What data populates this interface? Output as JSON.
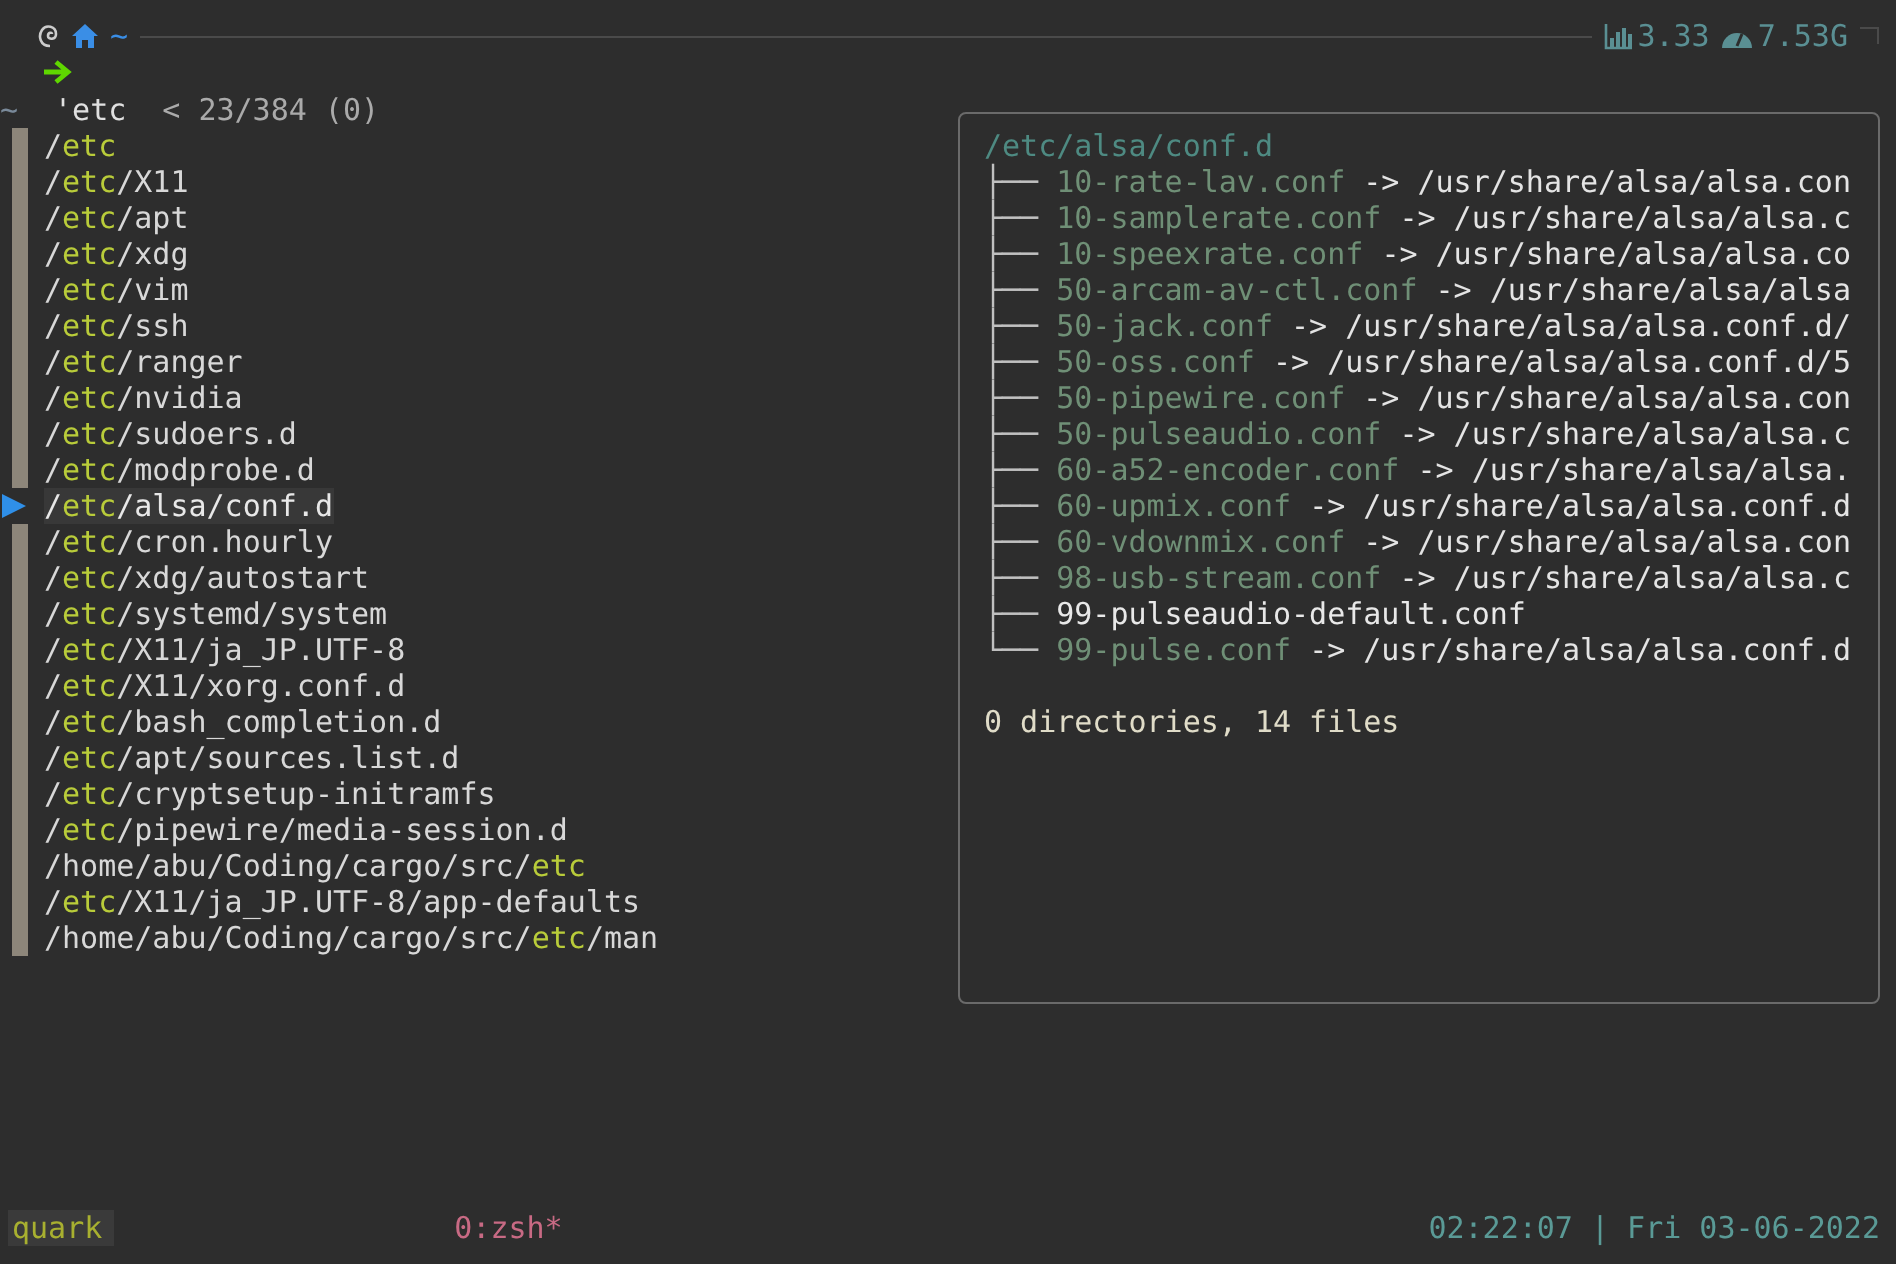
{
  "prompt": {
    "path": "~",
    "load": "3.33",
    "memory": "7.53G"
  },
  "query": {
    "dir": "~",
    "text": "'etc",
    "counter": "< 23/384 (0)"
  },
  "results": [
    {
      "selected": false,
      "parts": [
        {
          "text": "/"
        },
        {
          "text": "etc",
          "match": true
        }
      ]
    },
    {
      "selected": false,
      "parts": [
        {
          "text": "/"
        },
        {
          "text": "etc",
          "match": true
        },
        {
          "text": "/X11"
        }
      ]
    },
    {
      "selected": false,
      "parts": [
        {
          "text": "/"
        },
        {
          "text": "etc",
          "match": true
        },
        {
          "text": "/apt"
        }
      ]
    },
    {
      "selected": false,
      "parts": [
        {
          "text": "/"
        },
        {
          "text": "etc",
          "match": true
        },
        {
          "text": "/xdg"
        }
      ]
    },
    {
      "selected": false,
      "parts": [
        {
          "text": "/"
        },
        {
          "text": "etc",
          "match": true
        },
        {
          "text": "/vim"
        }
      ]
    },
    {
      "selected": false,
      "parts": [
        {
          "text": "/"
        },
        {
          "text": "etc",
          "match": true
        },
        {
          "text": "/ssh"
        }
      ]
    },
    {
      "selected": false,
      "parts": [
        {
          "text": "/"
        },
        {
          "text": "etc",
          "match": true
        },
        {
          "text": "/ranger"
        }
      ]
    },
    {
      "selected": false,
      "parts": [
        {
          "text": "/"
        },
        {
          "text": "etc",
          "match": true
        },
        {
          "text": "/nvidia"
        }
      ]
    },
    {
      "selected": false,
      "parts": [
        {
          "text": "/"
        },
        {
          "text": "etc",
          "match": true
        },
        {
          "text": "/sudoers.d"
        }
      ]
    },
    {
      "selected": false,
      "parts": [
        {
          "text": "/"
        },
        {
          "text": "etc",
          "match": true
        },
        {
          "text": "/modprobe.d"
        }
      ]
    },
    {
      "selected": true,
      "parts": [
        {
          "text": "/"
        },
        {
          "text": "etc",
          "match": true
        },
        {
          "text": "/alsa/conf.d"
        }
      ]
    },
    {
      "selected": false,
      "parts": [
        {
          "text": "/"
        },
        {
          "text": "etc",
          "match": true
        },
        {
          "text": "/cron.hourly"
        }
      ]
    },
    {
      "selected": false,
      "parts": [
        {
          "text": "/"
        },
        {
          "text": "etc",
          "match": true
        },
        {
          "text": "/xdg/autostart"
        }
      ]
    },
    {
      "selected": false,
      "parts": [
        {
          "text": "/"
        },
        {
          "text": "etc",
          "match": true
        },
        {
          "text": "/systemd/system"
        }
      ]
    },
    {
      "selected": false,
      "parts": [
        {
          "text": "/"
        },
        {
          "text": "etc",
          "match": true
        },
        {
          "text": "/X11/ja_JP.UTF-8"
        }
      ]
    },
    {
      "selected": false,
      "parts": [
        {
          "text": "/"
        },
        {
          "text": "etc",
          "match": true
        },
        {
          "text": "/X11/xorg.conf.d"
        }
      ]
    },
    {
      "selected": false,
      "parts": [
        {
          "text": "/"
        },
        {
          "text": "etc",
          "match": true
        },
        {
          "text": "/bash_completion.d"
        }
      ]
    },
    {
      "selected": false,
      "parts": [
        {
          "text": "/"
        },
        {
          "text": "etc",
          "match": true
        },
        {
          "text": "/apt/sources.list.d"
        }
      ]
    },
    {
      "selected": false,
      "parts": [
        {
          "text": "/"
        },
        {
          "text": "etc",
          "match": true
        },
        {
          "text": "/cryptsetup-initramfs"
        }
      ]
    },
    {
      "selected": false,
      "parts": [
        {
          "text": "/"
        },
        {
          "text": "etc",
          "match": true
        },
        {
          "text": "/pipewire/media-session.d"
        }
      ]
    },
    {
      "selected": false,
      "parts": [
        {
          "text": "/home/abu/Coding/cargo/src/"
        },
        {
          "text": "etc",
          "match": true
        }
      ]
    },
    {
      "selected": false,
      "parts": [
        {
          "text": "/"
        },
        {
          "text": "etc",
          "match": true
        },
        {
          "text": "/X11/ja_JP.UTF-8/app-defaults"
        }
      ]
    },
    {
      "selected": false,
      "parts": [
        {
          "text": "/home/abu/Coding/cargo/src/"
        },
        {
          "text": "etc",
          "match": true
        },
        {
          "text": "/man"
        }
      ]
    }
  ],
  "preview": {
    "header": "/etc/alsa/conf.d",
    "entries": [
      {
        "branch": "├──",
        "kind": "symlink",
        "name": "10-rate-lav.conf",
        "target": "-> /usr/share/alsa/alsa.con"
      },
      {
        "branch": "├──",
        "kind": "symlink",
        "name": "10-samplerate.conf",
        "target": "-> /usr/share/alsa/alsa.c"
      },
      {
        "branch": "├──",
        "kind": "symlink",
        "name": "10-speexrate.conf",
        "target": "-> /usr/share/alsa/alsa.co"
      },
      {
        "branch": "├──",
        "kind": "symlink",
        "name": "50-arcam-av-ctl.conf",
        "target": "-> /usr/share/alsa/alsa"
      },
      {
        "branch": "├──",
        "kind": "symlink",
        "name": "50-jack.conf",
        "target": "-> /usr/share/alsa/alsa.conf.d/"
      },
      {
        "branch": "├──",
        "kind": "symlink",
        "name": "50-oss.conf",
        "target": "-> /usr/share/alsa/alsa.conf.d/5"
      },
      {
        "branch": "├──",
        "kind": "symlink",
        "name": "50-pipewire.conf",
        "target": "-> /usr/share/alsa/alsa.con"
      },
      {
        "branch": "├──",
        "kind": "symlink",
        "name": "50-pulseaudio.conf",
        "target": "-> /usr/share/alsa/alsa.c"
      },
      {
        "branch": "├──",
        "kind": "symlink",
        "name": "60-a52-encoder.conf",
        "target": "-> /usr/share/alsa/alsa."
      },
      {
        "branch": "├──",
        "kind": "symlink",
        "name": "60-upmix.conf",
        "target": "-> /usr/share/alsa/alsa.conf.d"
      },
      {
        "branch": "├──",
        "kind": "symlink",
        "name": "60-vdownmix.conf",
        "target": "-> /usr/share/alsa/alsa.con"
      },
      {
        "branch": "├──",
        "kind": "symlink",
        "name": "98-usb-stream.conf",
        "target": "-> /usr/share/alsa/alsa.c"
      },
      {
        "branch": "├──",
        "kind": "file",
        "name": "99-pulseaudio-default.conf"
      },
      {
        "branch": "└──",
        "kind": "symlink",
        "name": "99-pulse.conf",
        "target": "-> /usr/share/alsa/alsa.conf.d"
      }
    ],
    "summary": "0 directories, 14 files"
  },
  "status_bar": {
    "session": "quark",
    "window": "0:zsh*",
    "clock": "02:22:07 | Fri 03-06-2022"
  }
}
